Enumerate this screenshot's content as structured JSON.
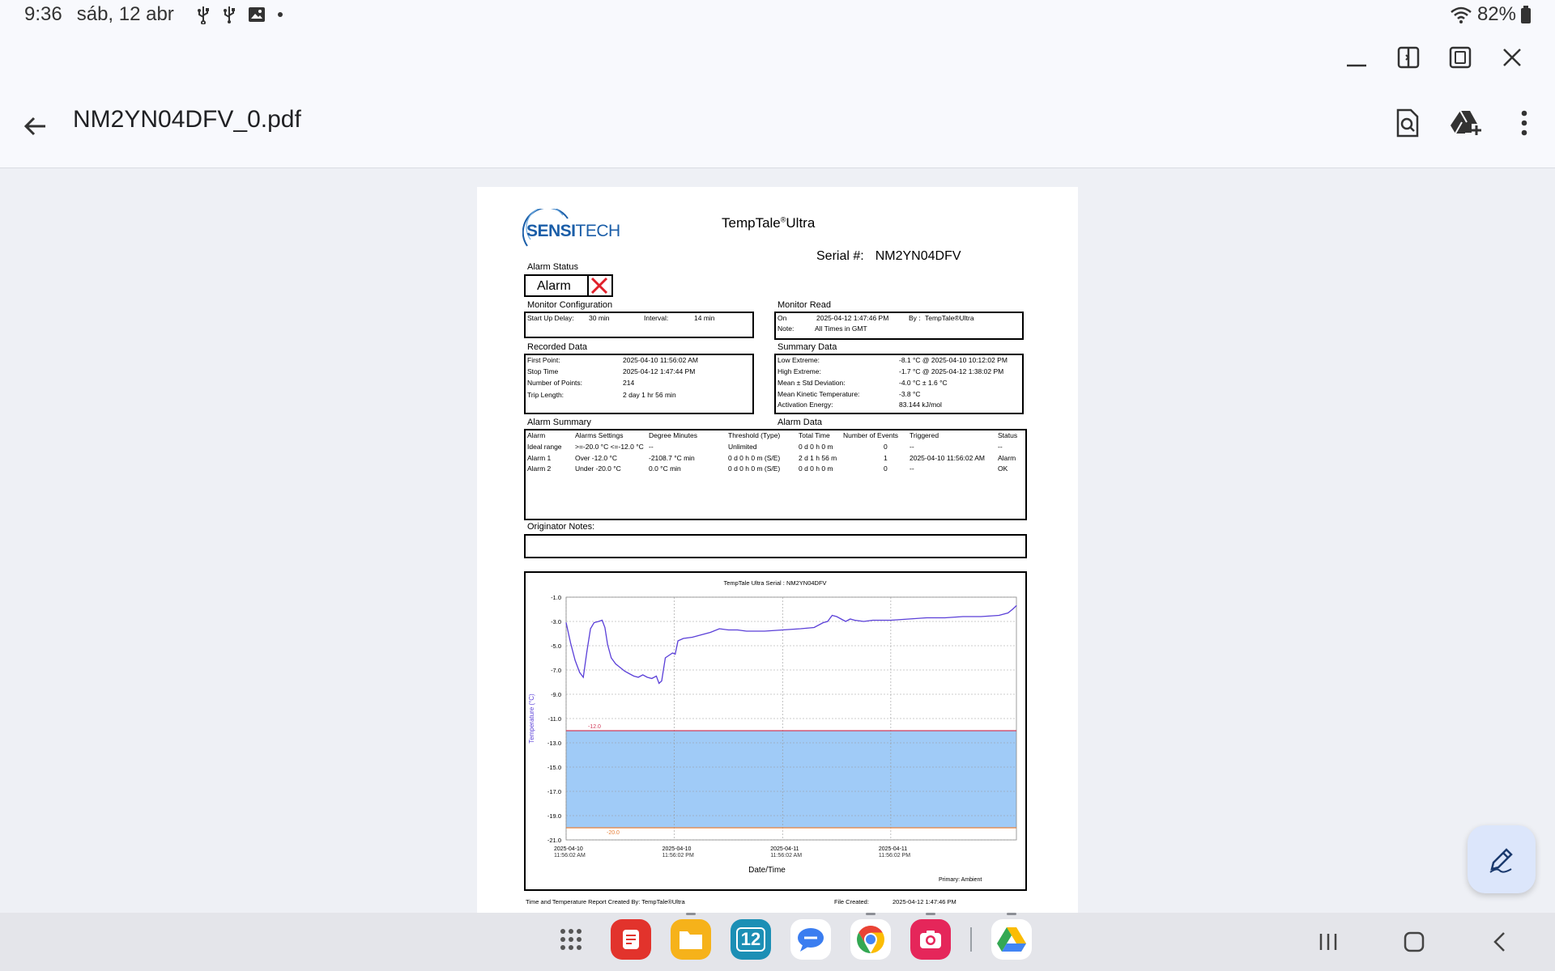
{
  "status_bar": {
    "time": "9:36",
    "date": "sáb, 12 abr",
    "battery": "82%"
  },
  "app": {
    "title": "NM2YN04DFV_0.pdf"
  },
  "document": {
    "logo_part1": "SENSI",
    "logo_part2": "TECH",
    "title": "TempTale",
    "title_sup": "®",
    "title_suffix": "Ultra",
    "serial_label": "Serial #:",
    "serial_value": "NM2YN04DFV",
    "alarm_status_label": "Alarm Status",
    "alarm_status_value": "Alarm",
    "monitor_config": {
      "heading": "Monitor Configuration",
      "startup_label": "Start Up Delay:",
      "startup_value": "30 min",
      "interval_label": "Interval:",
      "interval_value": "14 min"
    },
    "monitor_read": {
      "heading": "Monitor Read",
      "on_label": "On",
      "on_value": "2025-04-12  1:47:46 PM",
      "by_label": "By :",
      "by_value": "TempTale®Ultra",
      "note_label": "Note:",
      "note_value": "All Times in GMT"
    },
    "recorded_data": {
      "heading": "Recorded Data",
      "rows": [
        {
          "label": "First Point:",
          "value": "2025-04-10 11:56:02 AM"
        },
        {
          "label": "Stop Time",
          "value": "2025-04-12  1:47:44 PM"
        },
        {
          "label": "Number of Points:",
          "value": "214"
        },
        {
          "label": "Trip Length:",
          "value": "2 day 1 hr 56 min"
        }
      ]
    },
    "summary_data": {
      "heading": "Summary Data",
      "rows": [
        {
          "label": "Low Extreme:",
          "value": "-8.1 °C @ 2025-04-10 10:12:02 PM"
        },
        {
          "label": "High Extreme:",
          "value": "-1.7 °C @ 2025-04-12  1:38:02 PM"
        },
        {
          "label": "Mean ± Std Deviation:",
          "value": "-4.0 °C ± 1.6 °C"
        },
        {
          "label": "Mean Kinetic Temperature:",
          "value": "-3.8 °C"
        },
        {
          "label": "Activation Energy:",
          "value": "83.144 kJ/mol"
        }
      ]
    },
    "alarm_summary_heading": "Alarm Summary",
    "alarm_data_heading": "Alarm Data",
    "alarm_table": {
      "headers": [
        "Alarm",
        "Alarms Settings",
        "Degree Minutes",
        "Threshold (Type)",
        "Total Time",
        "Number of Events",
        "Triggered",
        "Status"
      ],
      "rows": [
        [
          "Ideal range",
          ">=-20.0 °C <=-12.0 °C",
          "--",
          "Unlimited",
          "0 d 0 h 0 m",
          "0",
          "--",
          "--"
        ],
        [
          "Alarm 1",
          "Over -12.0 °C",
          "-2108.7 °C min",
          "0 d 0 h 0 m (S/E)",
          "2 d 1 h 56 m",
          "1",
          "2025-04-10 11:56:02 AM",
          "Alarm"
        ],
        [
          "Alarm 2",
          "Under -20.0 °C",
          "0.0 °C min",
          "0 d 0 h 0 m (S/E)",
          "0 d 0 h 0 m",
          "0",
          "--",
          "OK"
        ]
      ]
    },
    "originator_notes_label": "Originator Notes:",
    "footer_left": "Time and Temperature Report Created By:  TempTale®Ultra",
    "footer_file_label": "File Created:",
    "footer_file_value": "2025-04-12  1:47:46 PM"
  },
  "chart_data": {
    "type": "line",
    "title": "TempTale Ultra  Serial : NM2YN04DFV",
    "xlabel": "Date/Time",
    "ylabel": "Temperature  (°C)",
    "footnote": "Primary: Ambient",
    "ylim": [
      -21.0,
      -1.0
    ],
    "yticks": [
      "-1.0",
      "-3.0",
      "-5.0",
      "-7.0",
      "-9.0",
      "-11.0",
      "-13.0",
      "-15.0",
      "-17.0",
      "-19.0",
      "-21.0"
    ],
    "xticks": [
      {
        "date": "2025-04-10",
        "time": "11:56:02 AM"
      },
      {
        "date": "2025-04-10",
        "time": "11:56:02 PM"
      },
      {
        "date": "2025-04-11",
        "time": "11:56:02 AM"
      },
      {
        "date": "2025-04-11",
        "time": "11:56:02 PM"
      }
    ],
    "xrange_hours": [
      0,
      49.93
    ],
    "threshold_high": {
      "value": -12.0,
      "label": "-12.0",
      "color": "#d23c5a"
    },
    "threshold_low": {
      "value": -20.0,
      "label": "-20.0",
      "color": "#e8803a"
    },
    "band_color": "#a0cbf7",
    "line_color": "#5a3fd8",
    "series": [
      {
        "points": [
          [
            0.0,
            -3.1
          ],
          [
            0.5,
            -4.8
          ],
          [
            1.0,
            -6.2
          ],
          [
            1.5,
            -7.2
          ],
          [
            1.9,
            -7.6
          ],
          [
            2.3,
            -5.5
          ],
          [
            2.7,
            -3.6
          ],
          [
            3.1,
            -3.1
          ],
          [
            3.6,
            -3.0
          ],
          [
            4.0,
            -2.9
          ],
          [
            4.3,
            -3.5
          ],
          [
            4.6,
            -4.9
          ],
          [
            5.0,
            -6.0
          ],
          [
            5.5,
            -6.5
          ],
          [
            6.0,
            -6.8
          ],
          [
            6.5,
            -7.1
          ],
          [
            7.0,
            -7.3
          ],
          [
            7.5,
            -7.5
          ],
          [
            8.0,
            -7.6
          ],
          [
            8.5,
            -7.4
          ],
          [
            9.0,
            -7.6
          ],
          [
            9.5,
            -7.7
          ],
          [
            10.0,
            -7.5
          ],
          [
            10.3,
            -8.1
          ],
          [
            10.6,
            -7.9
          ],
          [
            11.0,
            -6.0
          ],
          [
            11.4,
            -5.8
          ],
          [
            11.8,
            -5.6
          ],
          [
            12.1,
            -5.7
          ],
          [
            12.4,
            -4.6
          ],
          [
            13.0,
            -4.4
          ],
          [
            14.0,
            -4.3
          ],
          [
            15.0,
            -4.1
          ],
          [
            16.0,
            -3.9
          ],
          [
            17.0,
            -3.6
          ],
          [
            18.0,
            -3.7
          ],
          [
            19.0,
            -3.7
          ],
          [
            20.0,
            -3.8
          ],
          [
            22.0,
            -3.8
          ],
          [
            24.0,
            -3.7
          ],
          [
            26.0,
            -3.6
          ],
          [
            27.5,
            -3.5
          ],
          [
            28.5,
            -3.1
          ],
          [
            29.0,
            -3.0
          ],
          [
            29.5,
            -2.5
          ],
          [
            30.0,
            -2.6
          ],
          [
            30.5,
            -2.8
          ],
          [
            31.0,
            -3.0
          ],
          [
            31.5,
            -2.8
          ],
          [
            32.0,
            -2.9
          ],
          [
            33.0,
            -3.0
          ],
          [
            34.0,
            -2.9
          ],
          [
            35.0,
            -2.9
          ],
          [
            36.0,
            -2.9
          ],
          [
            38.0,
            -2.8
          ],
          [
            40.0,
            -2.7
          ],
          [
            42.0,
            -2.7
          ],
          [
            44.0,
            -2.6
          ],
          [
            46.0,
            -2.6
          ],
          [
            48.0,
            -2.5
          ],
          [
            49.0,
            -2.3
          ],
          [
            49.5,
            -2.0
          ],
          [
            49.93,
            -1.7
          ]
        ]
      }
    ]
  },
  "dock": {
    "apps": [
      "apps-grid",
      "notes",
      "files",
      "calendar",
      "messages",
      "chrome",
      "camera",
      "drive"
    ],
    "calendar_day": "12"
  }
}
